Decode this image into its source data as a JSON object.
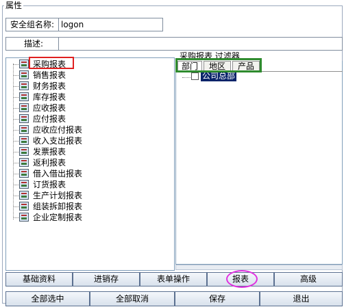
{
  "group": {
    "title": "属性"
  },
  "form": {
    "security_group_label": "安全组名称:",
    "security_group_value": "logon",
    "description_label": "描述:",
    "description_value": ""
  },
  "tree": {
    "items": [
      {
        "label": "采购报表"
      },
      {
        "label": "销售报表"
      },
      {
        "label": "财务报表"
      },
      {
        "label": "库存报表"
      },
      {
        "label": "应收报表"
      },
      {
        "label": "应付报表"
      },
      {
        "label": "应收应付报表"
      },
      {
        "label": "收入支出报表"
      },
      {
        "label": "发票报表"
      },
      {
        "label": "返利报表"
      },
      {
        "label": "借入借出报表"
      },
      {
        "label": "订货报表"
      },
      {
        "label": "生产计划报表"
      },
      {
        "label": "组装拆卸报表"
      },
      {
        "label": "企业定制报表"
      }
    ]
  },
  "filter": {
    "header": "采购报表 过滤器",
    "tabs": [
      {
        "label": "部门",
        "active": true
      },
      {
        "label": "地区",
        "active": false
      },
      {
        "label": "产品",
        "active": false
      }
    ],
    "node_label": "公司总部",
    "node_checked": false
  },
  "category_buttons": [
    {
      "label": "基础资料"
    },
    {
      "label": "进销存"
    },
    {
      "label": "表单操作"
    },
    {
      "label": "报表",
      "selected": true
    },
    {
      "label": "高级"
    }
  ],
  "action_buttons": [
    {
      "label": "全部选中"
    },
    {
      "label": "全部取消"
    },
    {
      "label": "保存"
    },
    {
      "label": "退出"
    }
  ],
  "colors": {
    "selection_bg": "#0a246a",
    "annotation_red": "#e02020",
    "annotation_green": "#2e8b2e",
    "annotation_pink": "#e030e0"
  }
}
